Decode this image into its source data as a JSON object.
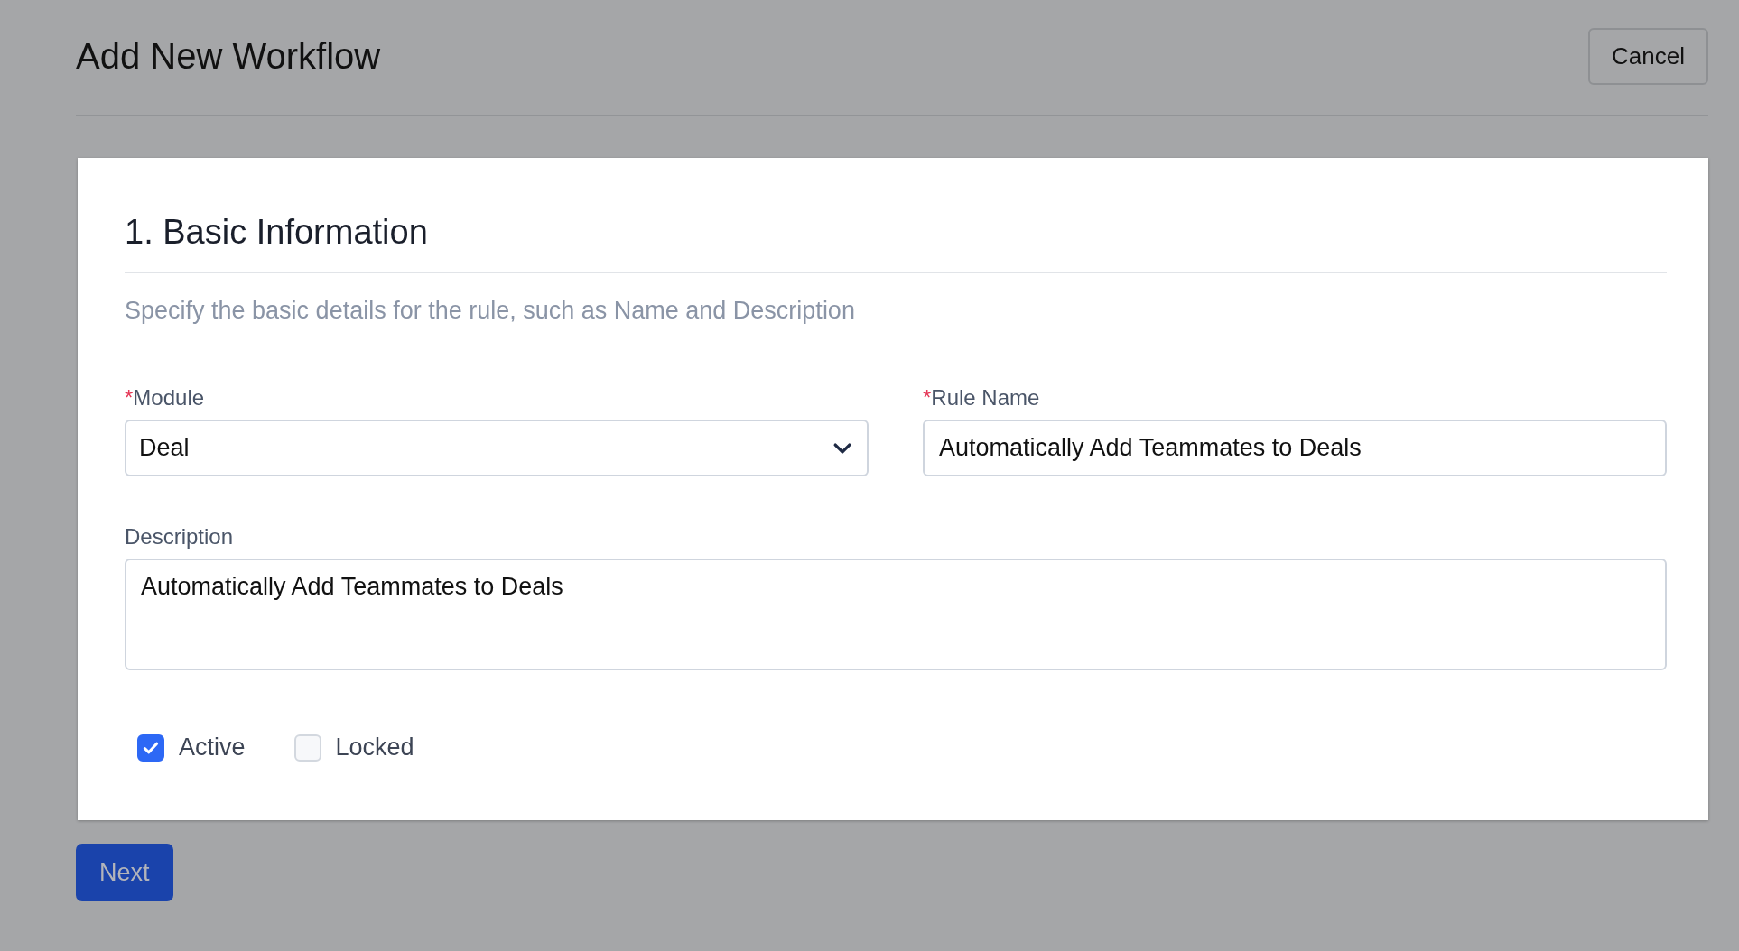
{
  "header": {
    "title": "Add New Workflow",
    "cancel_button": "Cancel"
  },
  "section": {
    "title": "1. Basic Information",
    "description": "Specify the basic details for the rule, such as Name and Description",
    "fields": [
      {
        "kind": "select",
        "label": "Module",
        "required_mark": "*",
        "value": "Deal"
      },
      {
        "kind": "text",
        "label": "Rule Name",
        "required_mark": "*",
        "value": "Automatically Add Teammates to Deals"
      },
      {
        "kind": "textarea",
        "label": "Description",
        "value": "Automatically Add Teammates to Deals"
      }
    ],
    "checkboxes": [
      {
        "label": "Active",
        "checked": true
      },
      {
        "label": "Locked",
        "checked": false
      }
    ]
  },
  "next_button": "Next"
}
